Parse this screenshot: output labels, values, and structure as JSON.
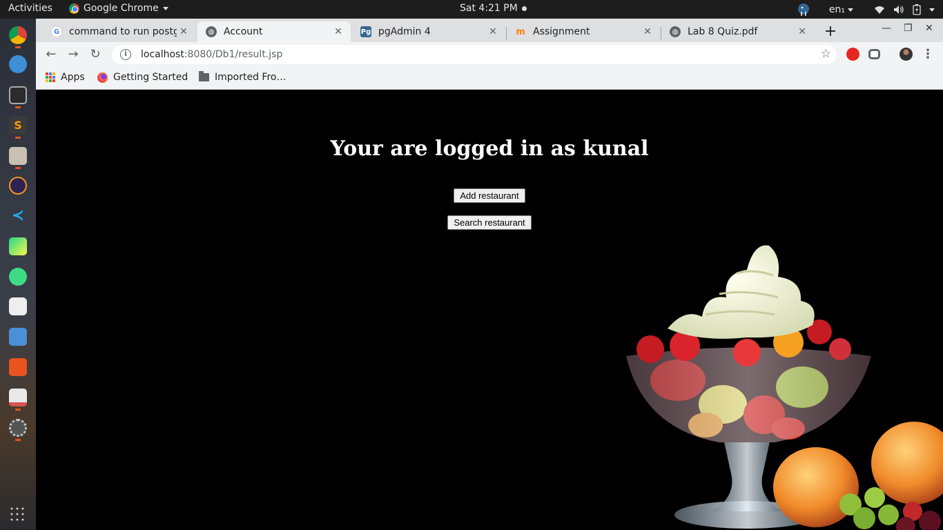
{
  "system": {
    "activities": "Activities",
    "app_name": "Google Chrome",
    "clock": "Sat  4:21 PM",
    "keyboard": "en₁"
  },
  "browser": {
    "tabs": [
      {
        "title": "command to run postgr",
        "favicon": "google-g-icon",
        "active": false
      },
      {
        "title": "Account",
        "favicon": "globe-icon",
        "active": true
      },
      {
        "title": "pgAdmin 4",
        "favicon": "pgadmin-icon",
        "active": false
      },
      {
        "title": "Assignment",
        "favicon": "moodle-icon",
        "active": false
      },
      {
        "title": "Lab 8 Quiz.pdf",
        "favicon": "globe-icon",
        "active": false
      }
    ],
    "url_host": "localhost",
    "url_path": ":8080/Db1/result.jsp",
    "bookmarks": [
      {
        "label": "Apps",
        "icon": "apps-grid-icon"
      },
      {
        "label": "Getting Started",
        "icon": "firefox-icon"
      },
      {
        "label": "Imported Fro…",
        "icon": "folder-icon"
      }
    ]
  },
  "page": {
    "heading": "Your are logged in as kunal",
    "add_button": "Add restaurant",
    "search_button": "Search restaurant",
    "background_color": "#000000"
  }
}
